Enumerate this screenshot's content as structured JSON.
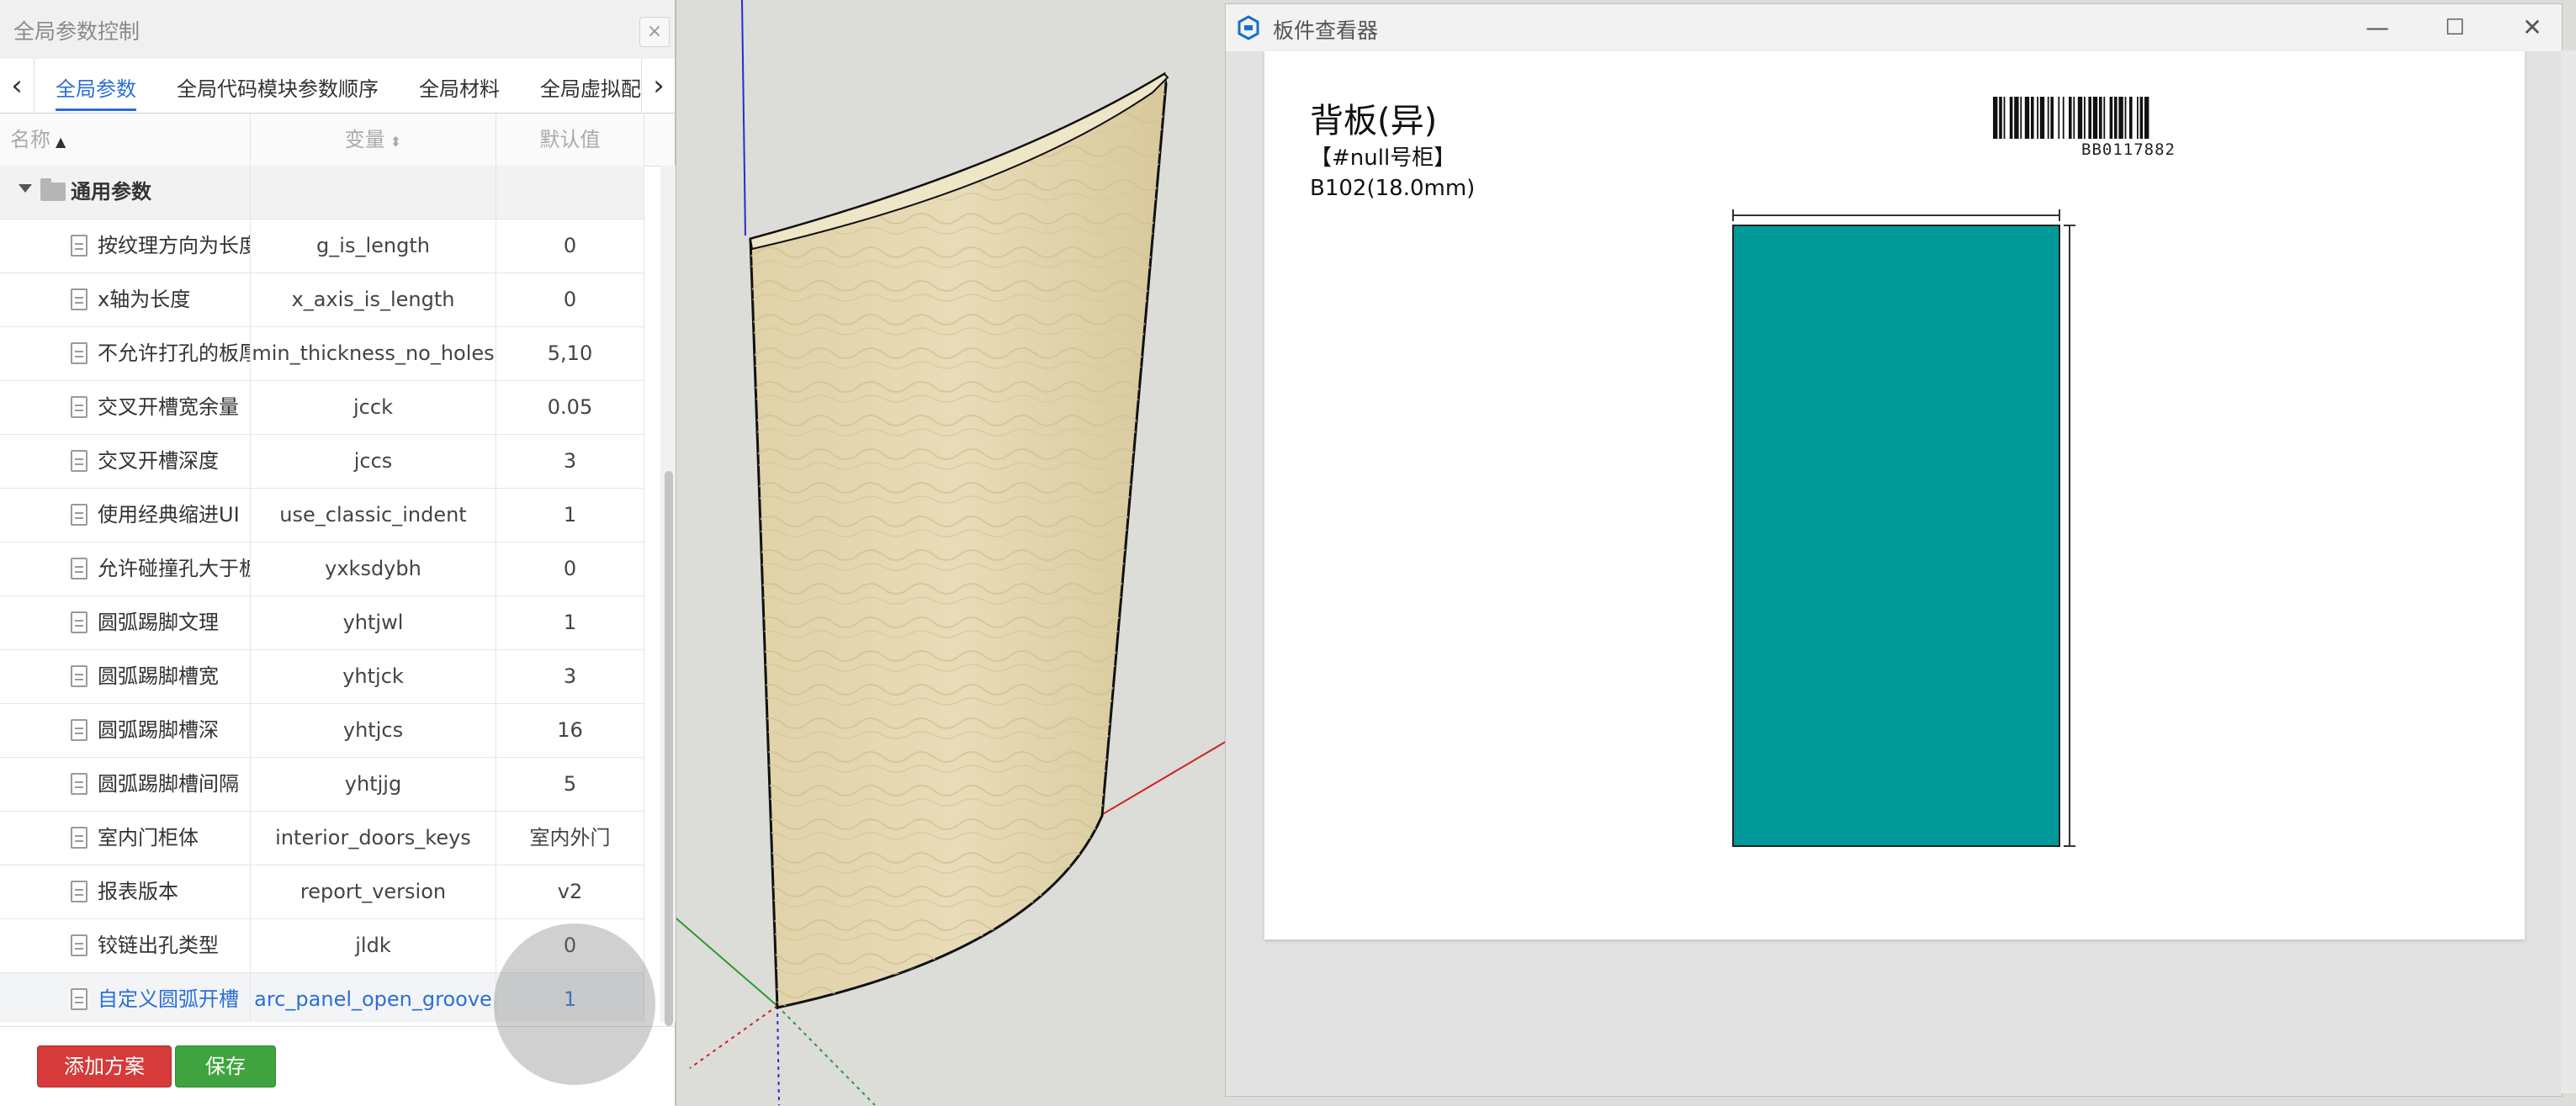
{
  "param_panel": {
    "title": "全局参数控制",
    "close_glyph": "×",
    "tabs": [
      {
        "label": "全局参数",
        "active": true
      },
      {
        "label": "全局代码模块参数顺序",
        "active": false
      },
      {
        "label": "全局材料",
        "active": false
      },
      {
        "label": "全局虚拟配件",
        "active": false
      }
    ],
    "columns": {
      "name": "名称",
      "variable": "变量",
      "default": "默认值"
    },
    "group": {
      "label": "通用参数"
    },
    "rows": [
      {
        "name": "按纹理方向为长度",
        "variable": "g_is_length",
        "default": "0"
      },
      {
        "name": "x轴为长度",
        "variable": "x_axis_is_length",
        "default": "0"
      },
      {
        "name": "不允许打孔的板厚",
        "variable": "min_thickness_no_holes",
        "default": "5,10"
      },
      {
        "name": "交叉开槽宽余量",
        "variable": "jcck",
        "default": "0.05"
      },
      {
        "name": "交叉开槽深度",
        "variable": "jccs",
        "default": "3"
      },
      {
        "name": "使用经典缩进UI",
        "variable": "use_classic_indent",
        "default": "1"
      },
      {
        "name": "允许碰撞孔大于板",
        "variable": "yxksdybh",
        "default": "0"
      },
      {
        "name": "圆弧踢脚文理",
        "variable": "yhtjwl",
        "default": "1"
      },
      {
        "name": "圆弧踢脚槽宽",
        "variable": "yhtjck",
        "default": "3"
      },
      {
        "name": "圆弧踢脚槽深",
        "variable": "yhtjcs",
        "default": "16"
      },
      {
        "name": "圆弧踢脚槽间隔",
        "variable": "yhtjjg",
        "default": "5"
      },
      {
        "name": "室内门柜体",
        "variable": "interior_doors_keys",
        "default": "室内外门"
      },
      {
        "name": "报表版本",
        "variable": "report_version",
        "default": "v2"
      },
      {
        "name": "铰链出孔类型",
        "variable": "jldk",
        "default": "0"
      },
      {
        "name": "自定义圆弧开槽",
        "variable": "arc_panel_open_groove",
        "default": "1"
      }
    ],
    "selected_row_index": 14,
    "buttons": {
      "add_scheme": "添加方案",
      "save": "保存"
    },
    "colors": {
      "accent": "#2c6fd6",
      "add_button": "#d63a3a",
      "save_button": "#3fa43f"
    }
  },
  "viewer": {
    "title": "板件查看器",
    "panel_name": "背板(异)",
    "cabinet_no": "【#null号柜】",
    "material": "B102(18.0mm)",
    "barcode_text": "BB0117882",
    "panel_color": "#009999"
  },
  "icons": {
    "tab_prev": "chevron-left-icon",
    "tab_next": "chevron-right-icon",
    "sort": "sort-icon",
    "folder": "folder-icon",
    "row": "document-icon",
    "viewer_logo": "app-logo-icon",
    "minimize": "minimize-icon",
    "maximize": "maximize-icon",
    "close": "close-icon"
  }
}
